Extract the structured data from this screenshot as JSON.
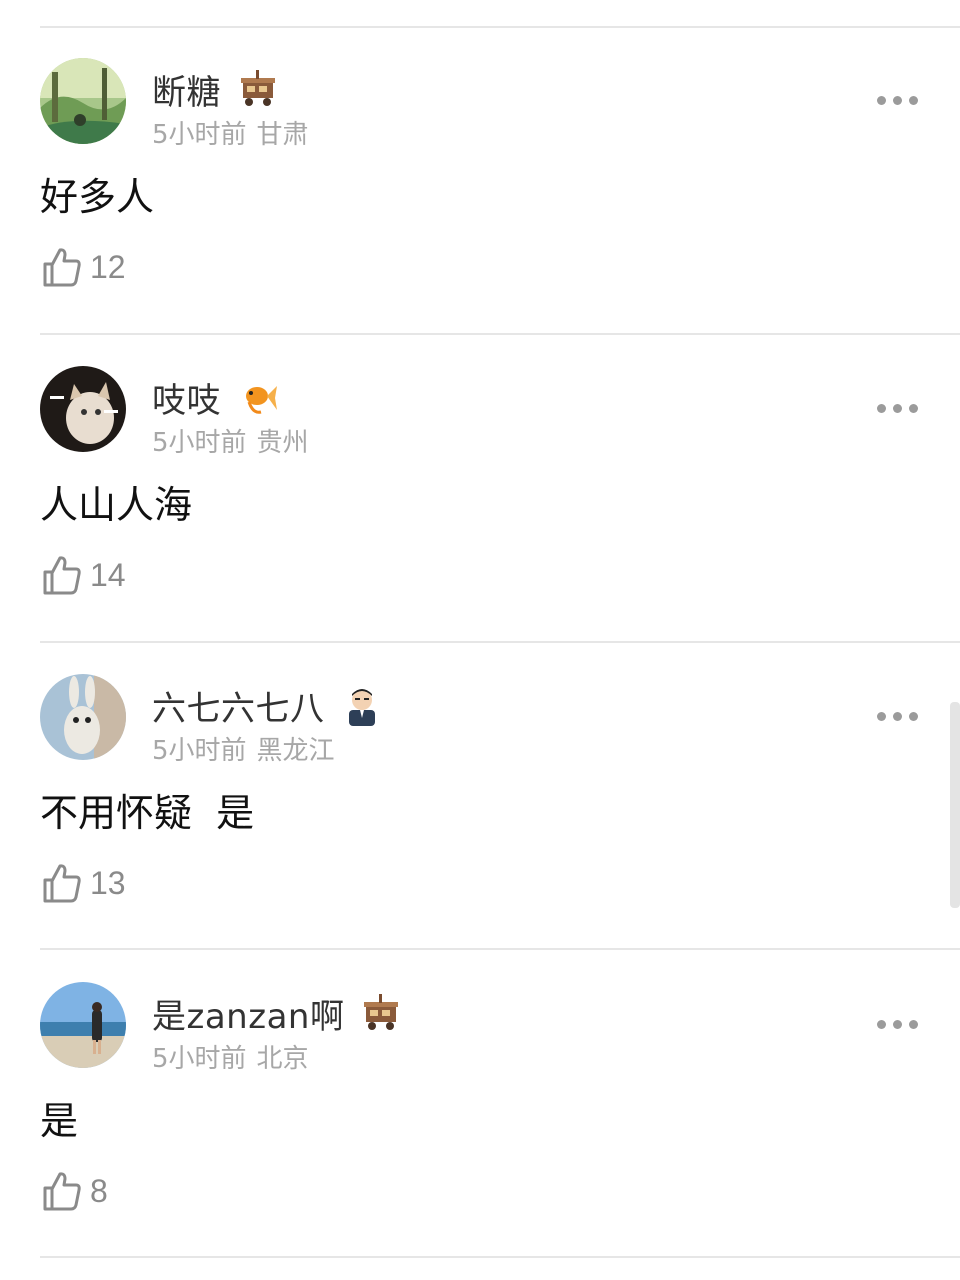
{
  "comments": [
    {
      "username": "断糖",
      "badge": "food-stall-badge-icon",
      "time": "5小时前",
      "location": "甘肃",
      "content": "好多人",
      "likes": "12",
      "avatar": "forest-scene-avatar"
    },
    {
      "username": "吱吱",
      "badge": "goldfish-badge-icon",
      "time": "5小时前",
      "location": "贵州",
      "content": "人山人海",
      "likes": "14",
      "avatar": "kitten-avatar"
    },
    {
      "username": "六七六七八",
      "badge": "man-in-suit-badge-icon",
      "time": "5小时前",
      "location": "黑龙江",
      "content": "不用怀疑  是",
      "likes": "13",
      "avatar": "rabbit-toy-avatar"
    },
    {
      "username": "是zanzan啊",
      "badge": "food-stall-badge-icon",
      "time": "5小时前",
      "location": "北京",
      "content": "是",
      "likes": "8",
      "avatar": "beach-person-avatar"
    }
  ],
  "colors": {
    "username": "#333333",
    "meta": "#a7a7a7",
    "content": "#111111",
    "like": "#8a8a8a",
    "separator": "#e6e6e6"
  }
}
